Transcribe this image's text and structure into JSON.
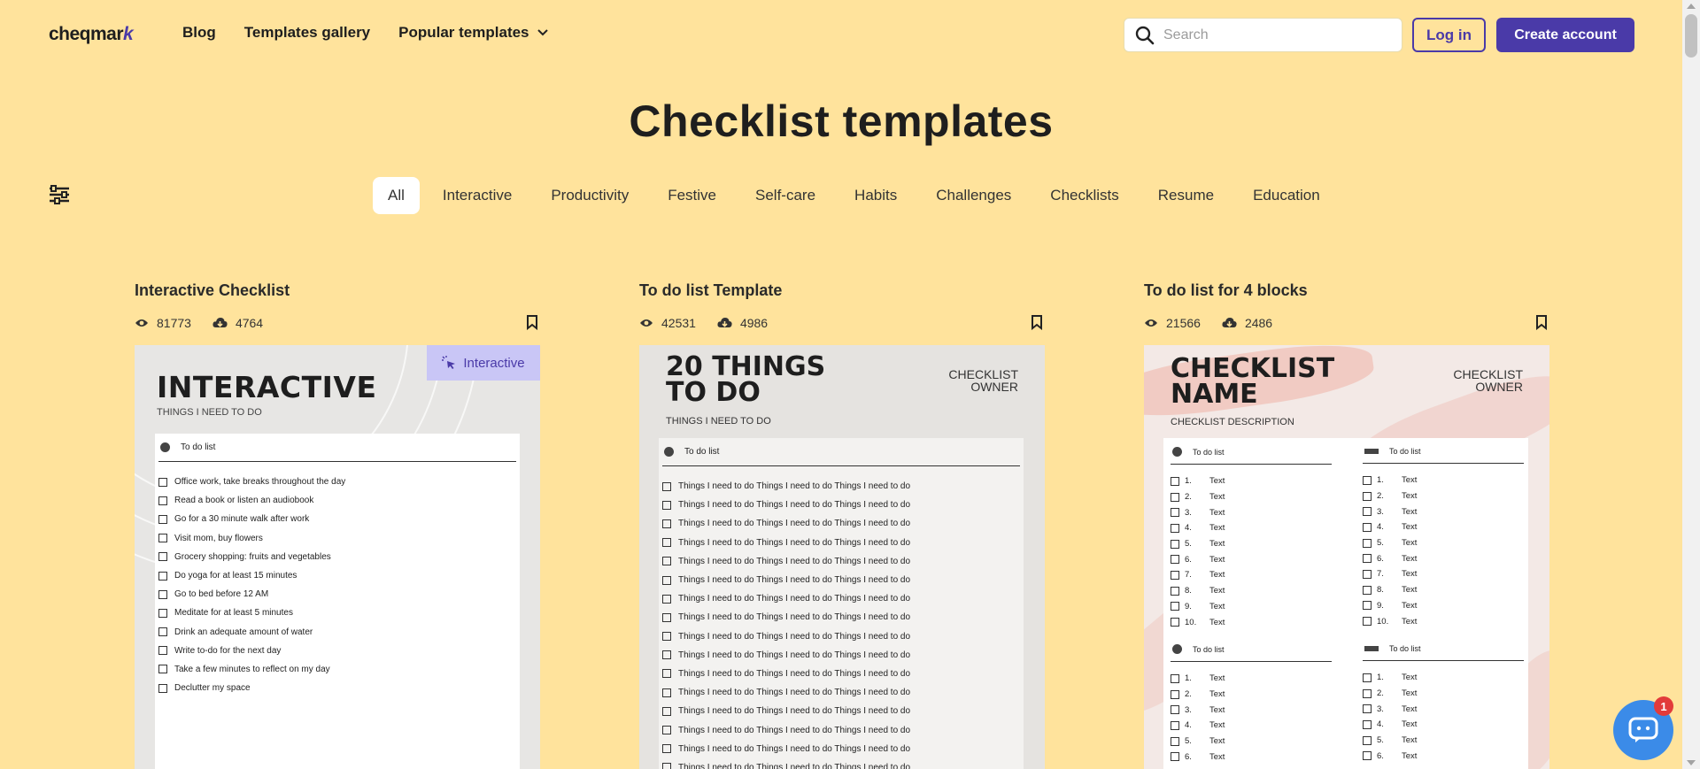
{
  "header": {
    "logo_text": "cheqmar",
    "logo_mark": "k",
    "nav": {
      "blog": "Blog",
      "templates_gallery": "Templates gallery",
      "popular_templates": "Popular templates"
    },
    "search_placeholder": "Search",
    "login_label": "Log in",
    "create_account_label": "Create account"
  },
  "page": {
    "title": "Checklist templates"
  },
  "filters": {
    "icon": "filter-icon",
    "tabs": [
      "All",
      "Interactive",
      "Productivity",
      "Festive",
      "Self-care",
      "Habits",
      "Challenges",
      "Checklists",
      "Resume",
      "Education"
    ],
    "active": "All"
  },
  "cards": [
    {
      "title": "Interactive Checklist",
      "views": "81773",
      "downloads": "4764",
      "badge": "Interactive",
      "preview": {
        "heading": "INTERACTIVE",
        "subheading": "THINGS I NEED TO DO",
        "list_title": "To do list",
        "items": [
          "Office work, take breaks throughout the day",
          "Read a book or listen an audiobook",
          "Go for a 30 minute walk after work",
          "Visit mom, buy flowers",
          "Grocery shopping: fruits and vegetables",
          "Do yoga for at least 15 minutes",
          "Go to bed before 12 AM",
          "Meditate for at least 5 minutes",
          "Drink an adequate amount of water",
          "Write to-do for the next day",
          "Take a few minutes to reflect on my day",
          "Declutter my space"
        ]
      }
    },
    {
      "title": "To do list Template",
      "views": "42531",
      "downloads": "4986",
      "preview": {
        "heading_line1": "20 THINGS",
        "heading_line2": "TO DO",
        "owner_line1": "CHECKLIST",
        "owner_line2": "OWNER",
        "subheading": "THINGS I NEED TO DO",
        "list_title": "To do list",
        "item_text": "Things I need to do Things I need to do Things I need to do"
      }
    },
    {
      "title": "To do list for 4 blocks",
      "views": "21566",
      "downloads": "2486",
      "preview": {
        "heading_line1": "CHECKLIST",
        "heading_line2": "NAME",
        "owner_line1": "CHECKLIST",
        "owner_line2": "OWNER",
        "subheading": "CHECKLIST DESCRIPTION",
        "list_title": "To do list",
        "item_text": "Text"
      }
    }
  ],
  "chat": {
    "icon": "chat-icon",
    "unread": "1"
  },
  "colors": {
    "background": "#ffe39c",
    "accent": "#4a3aa8",
    "chat": "#3b8be8",
    "badge": "#e23b3b"
  }
}
